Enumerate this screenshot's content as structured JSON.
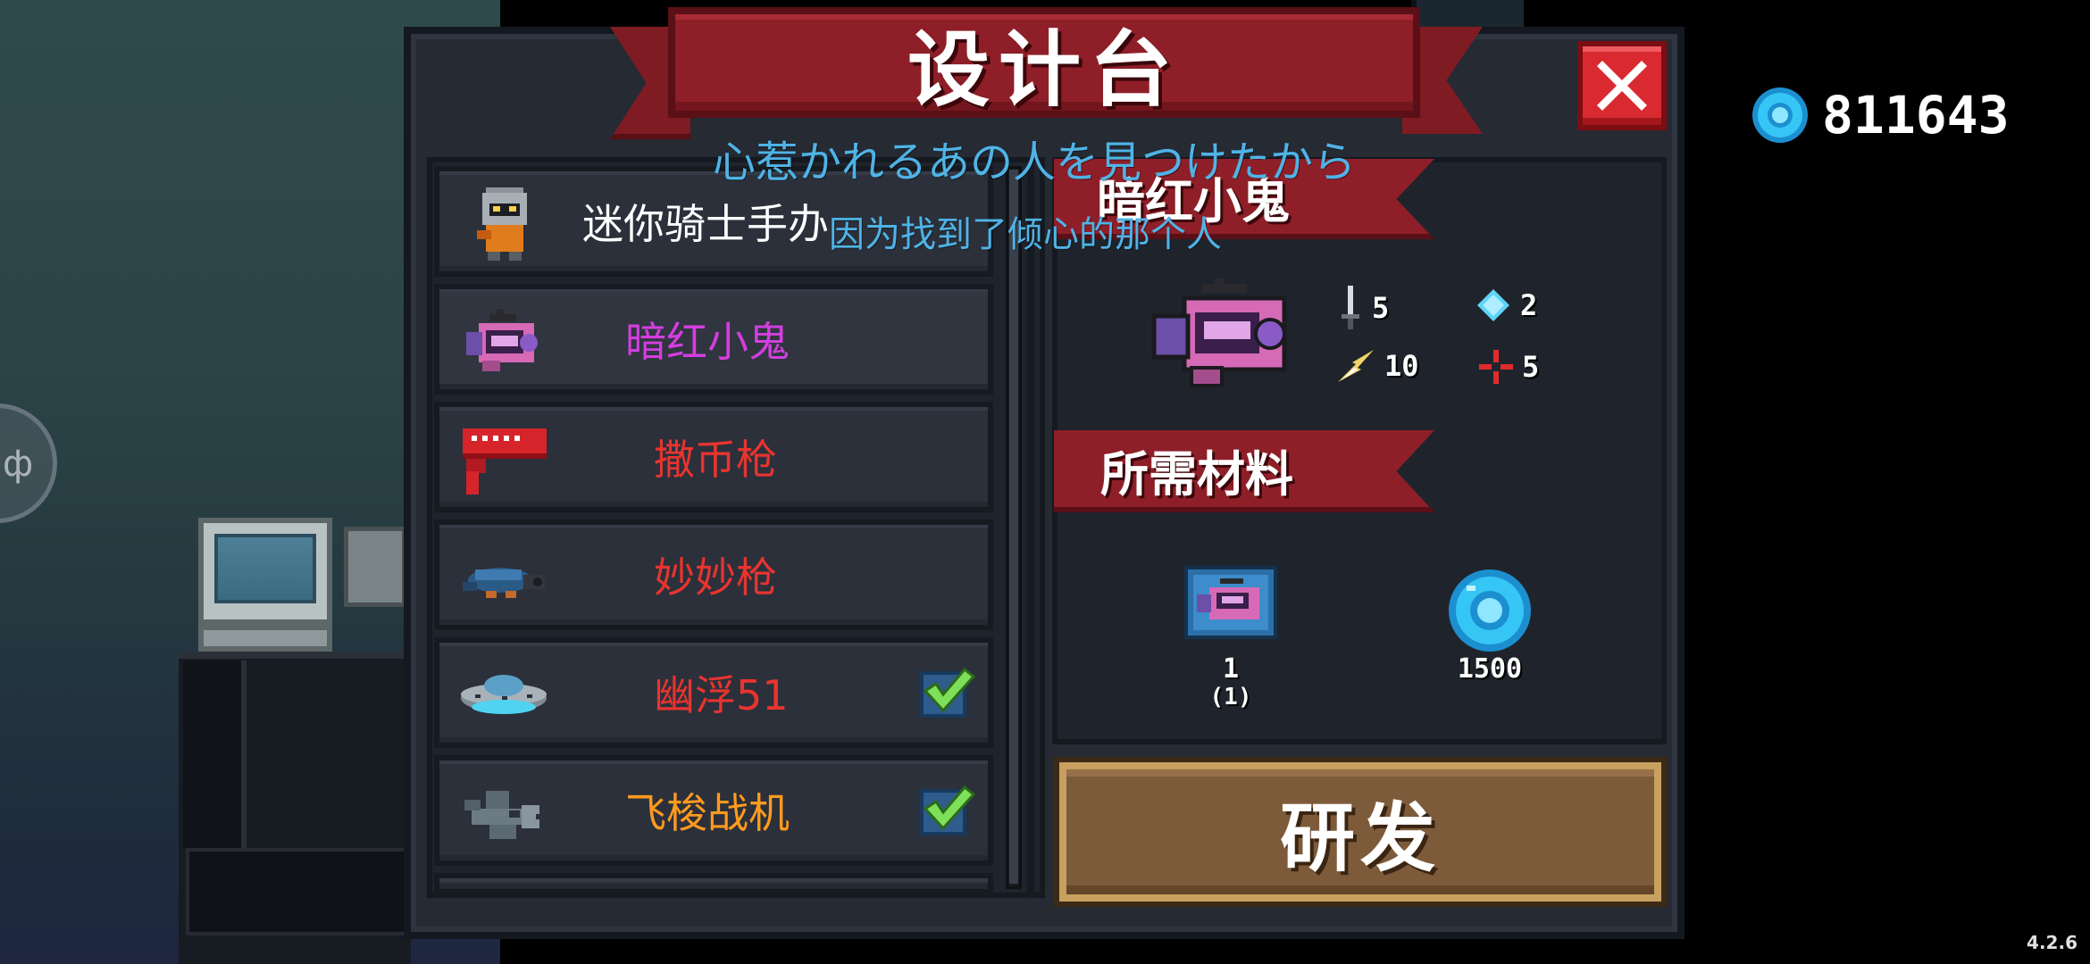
{
  "title": "设计台",
  "currency": {
    "value": "811643",
    "icon": "blue-gem-coin-icon"
  },
  "items": [
    {
      "label": "迷你骑士手办",
      "color": "#ffffff",
      "icon": "mini-knight-figure-icon",
      "checked": false
    },
    {
      "label": "暗红小鬼",
      "color": "#d43ee0",
      "icon": "pink-camera-gun-icon",
      "checked": false
    },
    {
      "label": "撒币枪",
      "color": "#e8342f",
      "icon": "red-coin-gun-icon",
      "checked": false
    },
    {
      "label": "妙妙枪",
      "color": "#e8342f",
      "icon": "turtle-gun-icon",
      "checked": false
    },
    {
      "label": "幽浮51",
      "color": "#e8342f",
      "icon": "ufo-icon",
      "checked": true
    },
    {
      "label": "飞梭战机",
      "color": "#ff9a1f",
      "icon": "fighter-jet-icon",
      "checked": true
    }
  ],
  "detail": {
    "name": "暗红小鬼",
    "stats": {
      "damage": "5",
      "energy": "2",
      "crit": "10",
      "accuracy": "5"
    },
    "materials_title": "所需材料",
    "materials": [
      {
        "icon": "blueprint-icon",
        "count": "1",
        "owned": "(1)"
      },
      {
        "icon": "blue-gem-coin-icon",
        "count": "1500"
      }
    ]
  },
  "research_button": "研发",
  "subtitles": {
    "japanese": "心惹かれるあの人を見つけたから",
    "chinese": "因为找到了倾心的那个人"
  },
  "version": "4.2.6"
}
